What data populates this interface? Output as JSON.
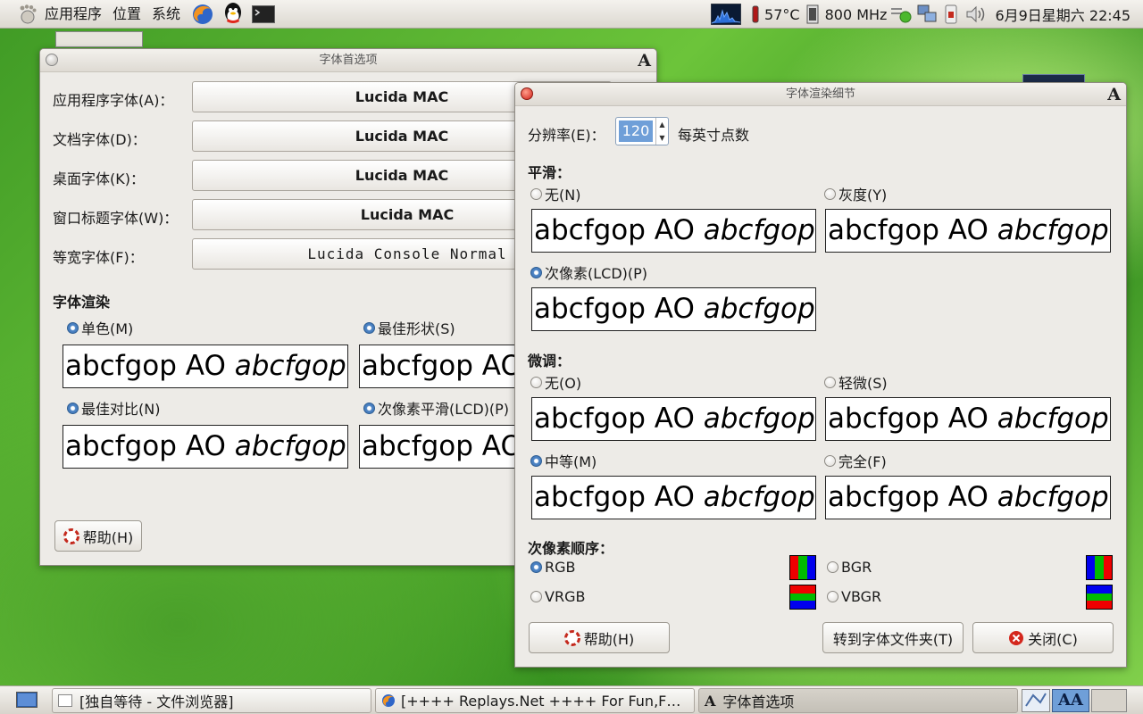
{
  "top_panel": {
    "menu": [
      "应用程序",
      "位置",
      "系统"
    ],
    "temperature": "57°C",
    "cpu_freq": "800 MHz",
    "datetime": "6月9日星期六 22:45"
  },
  "font_prefs": {
    "title": "字体首选项",
    "rows": [
      {
        "label": "应用程序字体(A)：",
        "value": "Lucida MAC"
      },
      {
        "label": "文档字体(D)：",
        "value": "Lucida MAC"
      },
      {
        "label": "桌面字体(K)：",
        "value": "Lucida MAC"
      },
      {
        "label": "窗口标题字体(W)：",
        "value": "Lucida MAC"
      },
      {
        "label": "等宽字体(F)：",
        "value": "Lucida Console Normal"
      }
    ],
    "rendering_title": "字体渲染",
    "options": [
      "单色(M)",
      "最佳形状(S)",
      "最佳对比(N)",
      "次像素平滑(LCD)(P)"
    ],
    "help": "帮助(H)"
  },
  "details": {
    "title": "字体渲染细节",
    "resolution_label": "分辨率(E)：",
    "resolution_value": "120",
    "resolution_unit": "每英寸点数",
    "smoothing_title": "平滑：",
    "smoothing": [
      "无(N)",
      "灰度(Y)",
      "次像素(LCD)(P)"
    ],
    "hinting_title": "微调：",
    "hinting": [
      "无(O)",
      "轻微(S)",
      "中等(M)",
      "完全(F)"
    ],
    "order_title": "次像素顺序：",
    "order": [
      "RGB",
      "BGR",
      "VRGB",
      "VBGR"
    ],
    "help": "帮助(H)",
    "goto_folder": "转到字体文件夹(T)",
    "close": "关闭(C)"
  },
  "sample": {
    "text": "abcfgop AO ",
    "italic": "abcfgop"
  },
  "taskbar": [
    "[独自等待 - 文件浏览器]",
    "[++++ Replays.Net ++++ For Fun,F…",
    "字体首选项"
  ],
  "colors": {
    "selection": "#6f9fd8",
    "radio_active": "#4f86c6",
    "desktop": "#5cb832"
  }
}
